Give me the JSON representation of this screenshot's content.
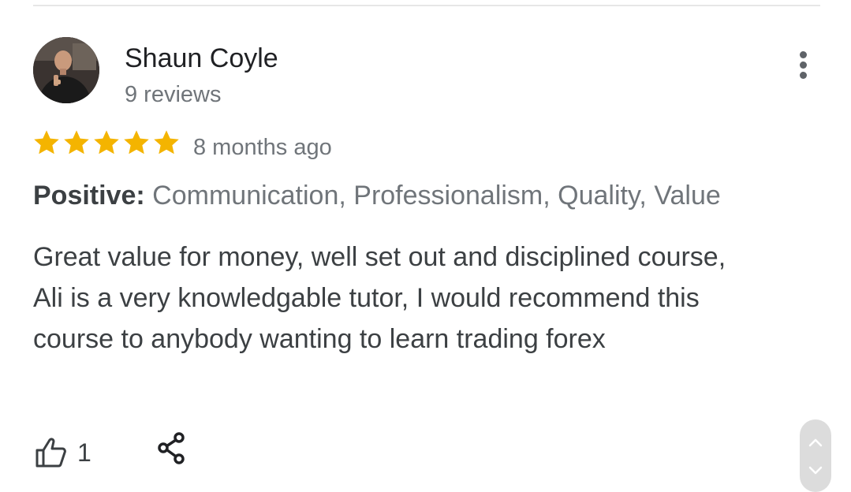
{
  "review": {
    "reviewer_name": "Shaun Coyle",
    "reviewer_meta": "9 reviews",
    "rating": 5,
    "rating_max": 5,
    "time_ago": "8 months ago",
    "highlights_label": "Positive:",
    "highlights_values": "Communication, Professionalism, Quality, Value",
    "body": "Great value for money, well set out and disciplined course, Ali is a very knowledgable tutor, I would recommend this course to anybody wanting to learn trading forex",
    "helpful_count": "1"
  },
  "icons": {
    "more": "more-vert-icon",
    "star": "star-icon",
    "like": "thumb-up-icon",
    "share": "share-icon",
    "scroll_up": "chevron-up-icon",
    "scroll_down": "chevron-down-icon"
  },
  "colors": {
    "star": "#f4b400",
    "text_primary": "#202124",
    "text_secondary": "#70757a",
    "text_body": "#3c4043",
    "divider": "#e6e6e6",
    "scroll_pill": "#dcdcdc"
  }
}
